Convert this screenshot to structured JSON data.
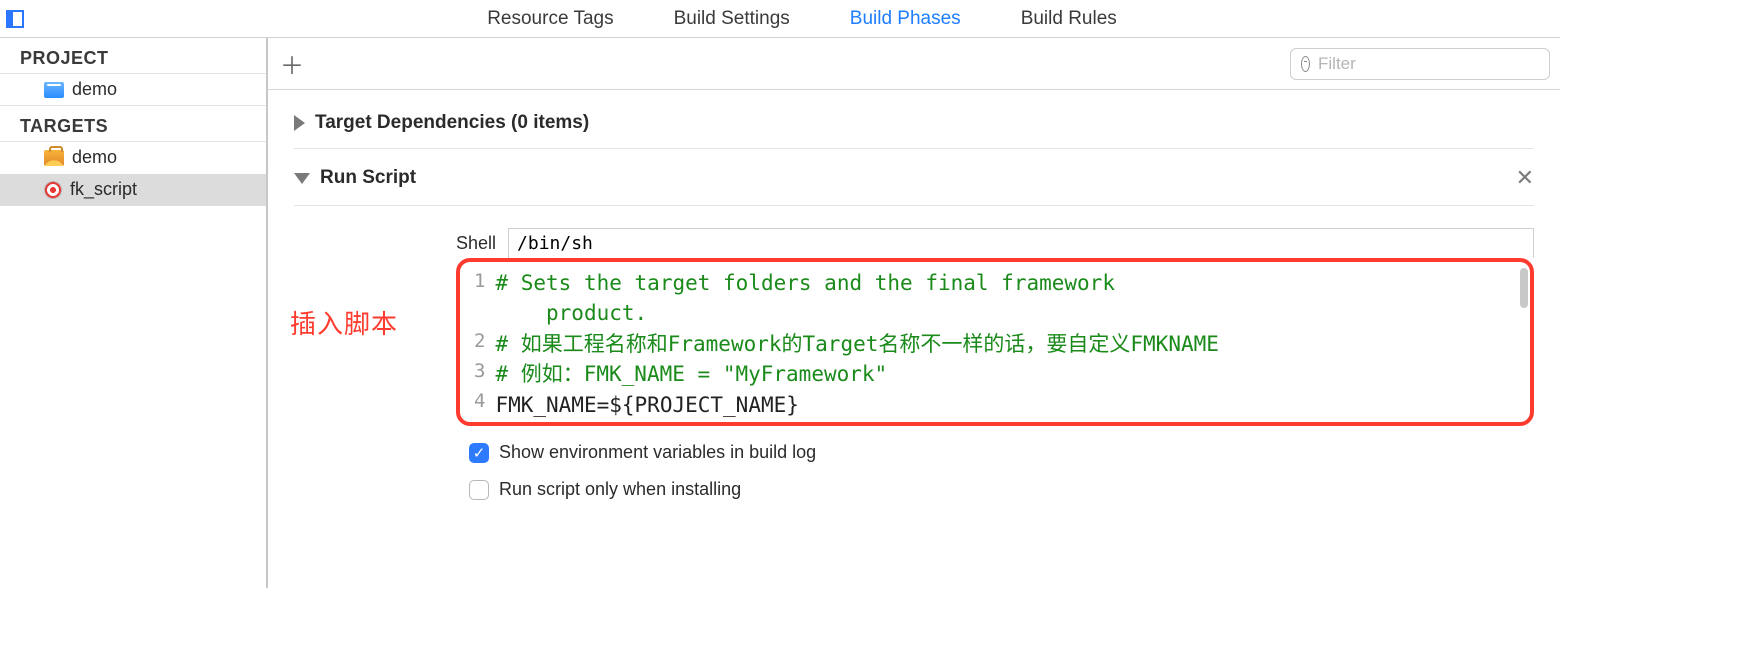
{
  "tabs": {
    "resource_tags": "Resource Tags",
    "build_settings": "Build Settings",
    "build_phases": "Build Phases",
    "build_rules": "Build Rules"
  },
  "sidebar": {
    "project_header": "PROJECT",
    "project_name": "demo",
    "targets_header": "TARGETS",
    "targets": [
      {
        "label": "demo"
      },
      {
        "label": "fk_script"
      }
    ]
  },
  "filter": {
    "placeholder": "Filter"
  },
  "phases": {
    "target_deps": "Target Dependencies (0 items)",
    "run_script": "Run Script"
  },
  "shell": {
    "label": "Shell",
    "value": "/bin/sh"
  },
  "annotation": "插入脚本",
  "script": {
    "lines": [
      {
        "n": "1",
        "cls": "c",
        "text": "# Sets the target folders and the final framework"
      },
      {
        "n": "",
        "cls": "c",
        "text": "    product."
      },
      {
        "n": "2",
        "cls": "c",
        "text": "# 如果工程名称和Framework的Target名称不一样的话，要自定义FMKNAME"
      },
      {
        "n": "3",
        "cls": "c",
        "text": "# 例如：FMK_NAME = \"MyFramework\""
      },
      {
        "n": "4",
        "cls": "n",
        "text": "FMK_NAME=${PROJECT_NAME}"
      }
    ]
  },
  "options": {
    "show_env": "Show environment variables in build log",
    "only_install": "Run script only when installing"
  }
}
